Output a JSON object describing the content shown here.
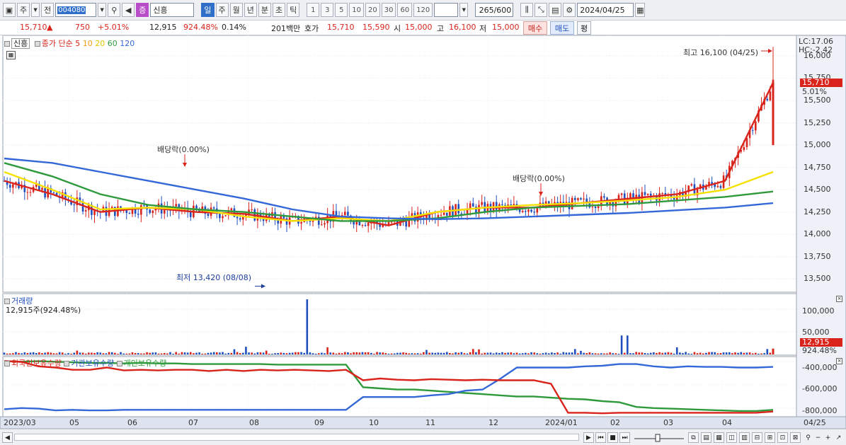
{
  "toolbar": {
    "market_label": "주",
    "prev_label": "전",
    "stock_code": "004080",
    "stock_name_prefix": "증",
    "stock_name": "신흥",
    "periods": [
      "일",
      "주",
      "월",
      "년",
      "분",
      "초",
      "틱"
    ],
    "active_period": "일",
    "intervals": [
      "1",
      "3",
      "5",
      "10",
      "20",
      "30",
      "60",
      "120"
    ],
    "count": "265",
    "count_max": "/600",
    "date": "2024/04/25"
  },
  "quote": {
    "price": "15,710",
    "change_arrow": "▲",
    "change": "750",
    "change_pct": "+5.01%",
    "volume": "12,915",
    "volume_ratio": "924.48%",
    "turnover": "0.14%",
    "amount": "201백만",
    "ask_label": "호가",
    "ask_price": "15,710",
    "bid_price": "15,590",
    "open_label": "시",
    "open": "15,000",
    "high_label": "고",
    "high": "16,100",
    "low_label": "저",
    "low": "15,000",
    "buy_button": "매수",
    "sell_button": "매도",
    "avg_button": "평"
  },
  "price_panel": {
    "legend_name": "신흥",
    "legend_type": "종가 단순",
    "ma_periods": [
      "5",
      "10",
      "20",
      "60",
      "120"
    ],
    "ma_colors": [
      "#d9241c",
      "#f39c12",
      "#f5e000",
      "#2e9a3c",
      "#3468d8"
    ],
    "lc_label": "LC:17.06",
    "hc_label": "HC:-2.42",
    "current_price": "15,710",
    "current_pct": "5.01%",
    "high_annotation": "최고 16,100 (04/25)",
    "low_annotation": "최저 13,420 (08/08)",
    "dividend_1": "배당락(0.00%)",
    "dividend_2": "배당락(0.00%)",
    "y_ticks": [
      "16,000",
      "15,750",
      "15,500",
      "15,250",
      "15,000",
      "14,750",
      "14,500",
      "14,250",
      "14,000",
      "13,750",
      "13,500"
    ]
  },
  "volume_panel": {
    "title": "거래량",
    "current": "12,915주(924.48%)",
    "y_ticks": [
      "100,000",
      "50,000"
    ],
    "current_value": "12,915",
    "current_ratio": "924.48%"
  },
  "holding_panel": {
    "series_labels": [
      "외국인보유수량",
      "기관보유수량",
      "개인보유수량"
    ],
    "series_colors": [
      "#d9241c",
      "#3468d8",
      "#2e9a3c"
    ],
    "y_ticks": [
      "-400,000",
      "-600,000",
      "-800,000"
    ]
  },
  "x_axis": {
    "labels": [
      "2023/03",
      "05",
      "06",
      "07",
      "08",
      "09",
      "10",
      "11",
      "12",
      "2024/01",
      "02",
      "03",
      "04"
    ],
    "last_label": "04/25"
  },
  "chart_data": {
    "type": "candlestick",
    "period": "daily",
    "x_range": [
      "2023/03",
      "2024/04/25"
    ],
    "y_range": [
      13400,
      16150
    ],
    "annotations": {
      "high": {
        "value": 16100,
        "date": "04/25"
      },
      "low": {
        "value": 13420,
        "date": "08/08"
      }
    },
    "ma_close_approx": [
      {
        "name": "5",
        "points": [
          14600,
          14450,
          14250,
          14300,
          14250,
          14230,
          14150,
          14200,
          14100,
          14250,
          14300,
          14300,
          14350,
          14400,
          14450,
          14600,
          15700
        ]
      },
      {
        "name": "20",
        "points": [
          14700,
          14500,
          14280,
          14300,
          14280,
          14200,
          14150,
          14180,
          14150,
          14250,
          14300,
          14330,
          14350,
          14380,
          14420,
          14500,
          14700
        ]
      },
      {
        "name": "60",
        "points": [
          14800,
          14650,
          14450,
          14330,
          14280,
          14250,
          14200,
          14150,
          14150,
          14180,
          14250,
          14300,
          14320,
          14340,
          14380,
          14420,
          14480
        ]
      },
      {
        "name": "120",
        "points": [
          14850,
          14800,
          14700,
          14600,
          14500,
          14400,
          14280,
          14200,
          14180,
          14170,
          14180,
          14200,
          14220,
          14240,
          14270,
          14300,
          14350
        ]
      }
    ],
    "volume_y_range": [
      0,
      130000
    ],
    "holdings_y_range": [
      -850000,
      -380000
    ]
  }
}
